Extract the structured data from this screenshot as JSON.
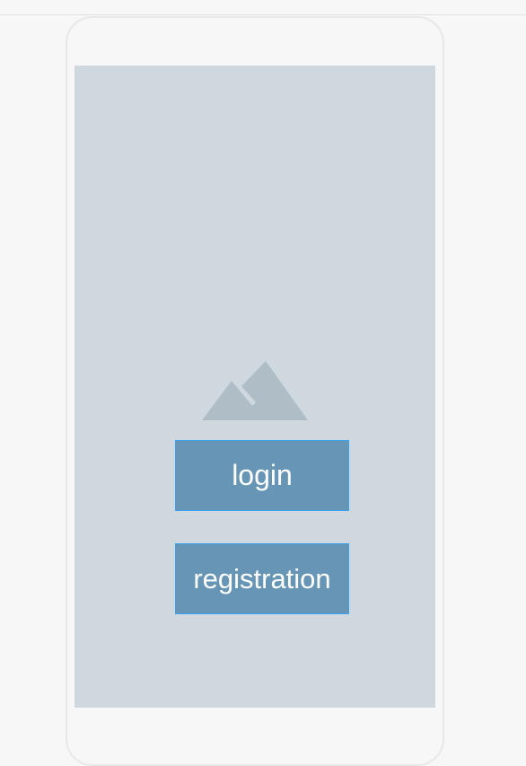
{
  "screen": {
    "image_placeholder_icon": "mountain-image-icon",
    "buttons": {
      "login_label": "login",
      "registration_label": "registration"
    }
  },
  "colors": {
    "page_background": "#f7f7f7",
    "screen_background": "#cfd8de",
    "button_fill": "#6695b5",
    "button_border": "#3aa2ee",
    "icon_color": "#afbec6"
  }
}
